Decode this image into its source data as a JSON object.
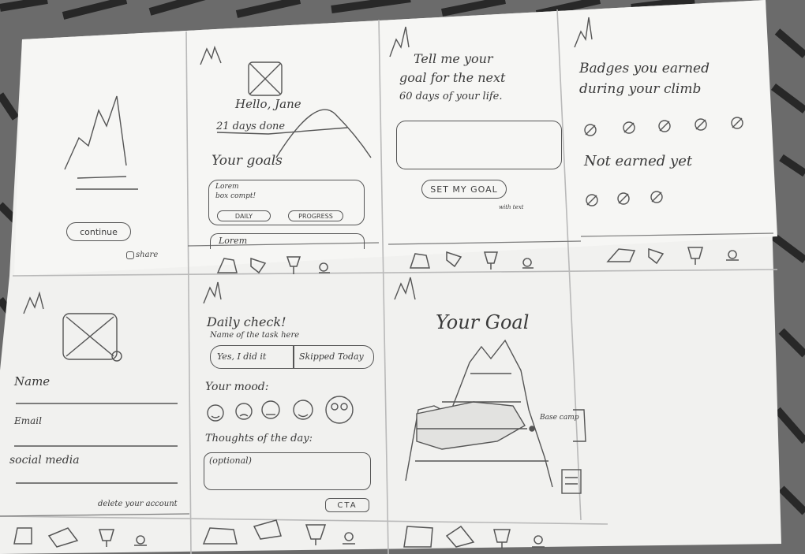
{
  "screens": {
    "start": {
      "continue_label": "continue",
      "share_label": "share"
    },
    "home": {
      "greeting": "Hello, Jane",
      "days_done": "21 days done",
      "goals_heading": "Your goals",
      "goal_card_text_1": "Lorem",
      "goal_card_text_2": "box compt!",
      "daily_label": "DAILY",
      "progress_label": "PROGRESS",
      "second_card_text": "Lorem"
    },
    "set_goal": {
      "prompt_line1": "Tell me your",
      "prompt_line2": "goal for the next",
      "prompt_line3": "60 days of your life.",
      "button_label": "SET MY GOAL",
      "note": "with text"
    },
    "badges": {
      "heading_line1": "Badges you earned",
      "heading_line2": "during your climb",
      "not_earned_label": "Not earned yet"
    },
    "profile": {
      "name_label": "Name",
      "email_label": "Email",
      "social_label": "social media",
      "delete_label": "delete your account"
    },
    "daily_check": {
      "title": "Daily check!",
      "task_name": "Name of the task here",
      "yes_label": "Yes, I did it",
      "skipped_label": "Skipped Today",
      "mood_label": "Your mood:",
      "thoughts_label": "Thoughts of the day:",
      "optional_placeholder": "(optional)",
      "cta_label": "CTA"
    },
    "your_goal": {
      "title": "Your Goal",
      "base_camp_label": "Base camp"
    }
  },
  "nav_icons": [
    "mountain-icon",
    "badge-icon",
    "trophy-icon",
    "person-icon"
  ],
  "colors": {
    "paper": "#f4f4f2",
    "pencil": "#4a4a4a",
    "background": "#5a5a5a"
  }
}
